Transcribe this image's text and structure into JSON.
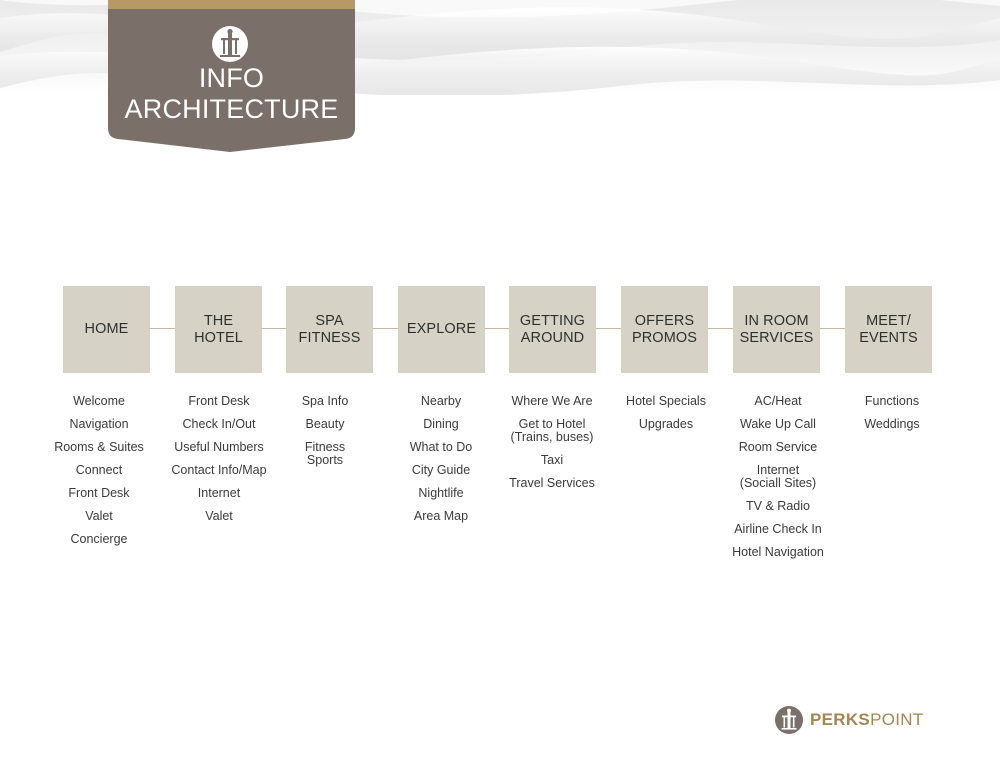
{
  "banner": {
    "title_line1": "INFO",
    "title_line2": "ARCHITECTURE"
  },
  "icons": {
    "banner_logo": "perkspoint-logo-icon",
    "brand_logo": "perkspoint-logo-icon"
  },
  "colors": {
    "banner": "#7a6f69",
    "banner_stripe": "#b89965",
    "box": "#d6d3c6",
    "connector": "#c8b8a3",
    "brand_gold": "#a68650"
  },
  "categories": [
    {
      "label": "HOME",
      "items": [
        "Welcome",
        "Navigation",
        "Rooms & Suites",
        "Connect",
        "Front Desk",
        "Valet",
        "Concierge"
      ]
    },
    {
      "label": "THE\nHOTEL",
      "items": [
        "Front Desk",
        "Check In/Out",
        "Useful Numbers",
        "Contact Info/Map",
        "Internet",
        "Valet"
      ]
    },
    {
      "label": "SPA\nFITNESS",
      "items": [
        "Spa Info",
        "Beauty",
        "Fitness\nSports"
      ]
    },
    {
      "label": "EXPLORE",
      "items": [
        "Nearby",
        "Dining",
        "What to Do",
        "City Guide",
        "Nightlife",
        "Area Map"
      ]
    },
    {
      "label": "GETTING\nAROUND",
      "items": [
        "Where We Are",
        "Get to Hotel\n(Trains, buses)",
        "Taxi",
        "Travel Services"
      ]
    },
    {
      "label": "OFFERS\nPROMOS",
      "items": [
        "Hotel Specials",
        "Upgrades"
      ]
    },
    {
      "label": "IN ROOM\nSERVICES",
      "items": [
        "AC/Heat",
        "Wake Up Call",
        "Room Service",
        "Internet\n(Sociall Sites)",
        "TV & Radio",
        "Airline Check In",
        "Hotel Navigation"
      ]
    },
    {
      "label": "MEET/\nEVENTS",
      "items": [
        "Functions",
        "Weddings"
      ]
    }
  ],
  "brand": {
    "bold": "PERKS",
    "regular": "POINT"
  }
}
